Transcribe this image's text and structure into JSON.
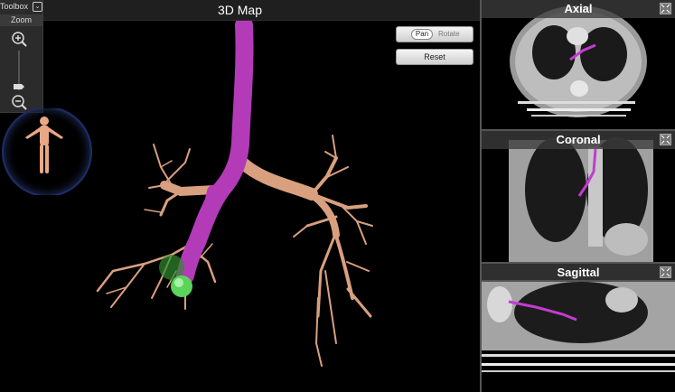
{
  "main": {
    "title": "3D Map"
  },
  "toolbox": {
    "title": "Toolbox",
    "toggle_icon": "chevron-down-icon",
    "zoom_label": "Zoom"
  },
  "controls": {
    "pan_label": "Pan",
    "rotate_label": "Rotate",
    "reset_label": "Reset",
    "active_mode": "Pan"
  },
  "panels": [
    {
      "title": "Axial"
    },
    {
      "title": "Coronal"
    },
    {
      "title": "Sagittal"
    }
  ],
  "colors": {
    "airway": "#d9a07f",
    "path": "#b33bb8",
    "target": "#44c744",
    "panel_header": "#3c3c3c"
  }
}
